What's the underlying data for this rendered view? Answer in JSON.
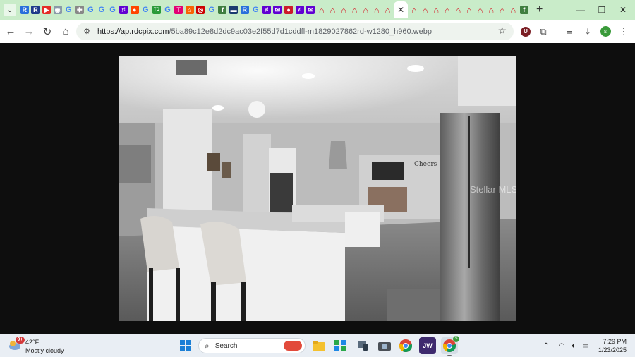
{
  "browser": {
    "tabs": [
      {
        "icon": "rdc-icon",
        "glyph": "R",
        "color": "#2a6fdb"
      },
      {
        "icon": "circle-icon",
        "glyph": "R",
        "color": "#1e3a8a"
      },
      {
        "icon": "youtube-icon",
        "glyph": "▶",
        "color": "#e52d27"
      },
      {
        "icon": "discord-icon",
        "glyph": "◉",
        "color": "#8a9aa8"
      },
      {
        "icon": "google-icon",
        "glyph": "G",
        "color": "#4285f4"
      },
      {
        "icon": "puzzle-icon",
        "glyph": "✚",
        "color": "#888888"
      },
      {
        "icon": "google-icon",
        "glyph": "G",
        "color": "#4285f4"
      },
      {
        "icon": "google-icon",
        "glyph": "G",
        "color": "#4285f4"
      },
      {
        "icon": "google-icon",
        "glyph": "G",
        "color": "#4285f4"
      },
      {
        "icon": "yahoo-icon",
        "glyph": "y!",
        "color": "#6001d2"
      },
      {
        "icon": "reddit-icon",
        "glyph": "●",
        "color": "#ff4500"
      },
      {
        "icon": "google-icon",
        "glyph": "G",
        "color": "#4285f4"
      },
      {
        "icon": "td-icon",
        "glyph": "TD",
        "color": "#2a9a3a"
      },
      {
        "icon": "google-icon",
        "glyph": "G",
        "color": "#4285f4"
      },
      {
        "icon": "tmobile-icon",
        "glyph": "T",
        "color": "#e20074"
      },
      {
        "icon": "homedepot-icon",
        "glyph": "⌂",
        "color": "#f96302"
      },
      {
        "icon": "target-icon",
        "glyph": "◎",
        "color": "#cc0000"
      },
      {
        "icon": "google-icon",
        "glyph": "G",
        "color": "#4285f4"
      },
      {
        "icon": "fidelity-icon",
        "glyph": "f",
        "color": "#3f7f3f"
      },
      {
        "icon": "news-icon",
        "glyph": "▬",
        "color": "#1b3b6f"
      },
      {
        "icon": "rdc-icon",
        "glyph": "R",
        "color": "#2a6fdb"
      },
      {
        "icon": "google-icon",
        "glyph": "G",
        "color": "#4285f4"
      },
      {
        "icon": "yahoo-icon",
        "glyph": "y!",
        "color": "#6001d2"
      },
      {
        "icon": "mail-icon",
        "glyph": "✉",
        "color": "#6001d2"
      },
      {
        "icon": "opera-icon",
        "glyph": "●",
        "color": "#cc1b2b"
      },
      {
        "icon": "yahoo-icon",
        "glyph": "y!",
        "color": "#6001d2"
      },
      {
        "icon": "mail-icon",
        "glyph": "✉",
        "color": "#6001d2"
      },
      {
        "icon": "house-icon",
        "glyph": "⌂",
        "color": "#d6202a"
      },
      {
        "icon": "house-icon",
        "glyph": "⌂",
        "color": "#d6202a"
      },
      {
        "icon": "house-icon",
        "glyph": "⌂",
        "color": "#d6202a"
      },
      {
        "icon": "house-icon",
        "glyph": "⌂",
        "color": "#d6202a"
      },
      {
        "icon": "house-icon",
        "glyph": "⌂",
        "color": "#d6202a"
      },
      {
        "icon": "house-icon",
        "glyph": "⌂",
        "color": "#d6202a"
      },
      {
        "icon": "house-icon",
        "glyph": "⌂",
        "color": "#d6202a"
      }
    ],
    "active_tab_close": "✕",
    "tabs_after": [
      {
        "icon": "house-icon",
        "glyph": "⌂",
        "color": "#d6202a"
      },
      {
        "icon": "house-icon",
        "glyph": "⌂",
        "color": "#d6202a"
      },
      {
        "icon": "house-icon",
        "glyph": "⌂",
        "color": "#d6202a"
      },
      {
        "icon": "house-icon",
        "glyph": "⌂",
        "color": "#d6202a"
      },
      {
        "icon": "house-icon",
        "glyph": "⌂",
        "color": "#d6202a"
      },
      {
        "icon": "house-icon",
        "glyph": "⌂",
        "color": "#d6202a"
      },
      {
        "icon": "house-icon",
        "glyph": "⌂",
        "color": "#d6202a"
      },
      {
        "icon": "house-icon",
        "glyph": "⌂",
        "color": "#d6202a"
      },
      {
        "icon": "house-icon",
        "glyph": "⌂",
        "color": "#d6202a"
      },
      {
        "icon": "house-icon",
        "glyph": "⌂",
        "color": "#d6202a"
      },
      {
        "icon": "fidelity-icon",
        "glyph": "f",
        "color": "#3f7f3f"
      }
    ],
    "new_tab_label": "+",
    "url_host": "https://ap.rdcpix.com",
    "url_path": "/5ba89c12e8d2dc9ac03e2f55d7d1cddfl-m1829027862rd-w1280_h960.webp",
    "extension_badge": "U",
    "profile_initial": "s"
  },
  "image": {
    "watermark": "Stellar MLS",
    "sign_text": "Cheers"
  },
  "taskbar": {
    "weather_badge": "9+",
    "temperature": "42°F",
    "condition": "Mostly cloudy",
    "search_label": "Search",
    "jw_label": "JW",
    "chrome_badge": "S",
    "time": "7:29 PM",
    "date": "1/23/2025"
  }
}
